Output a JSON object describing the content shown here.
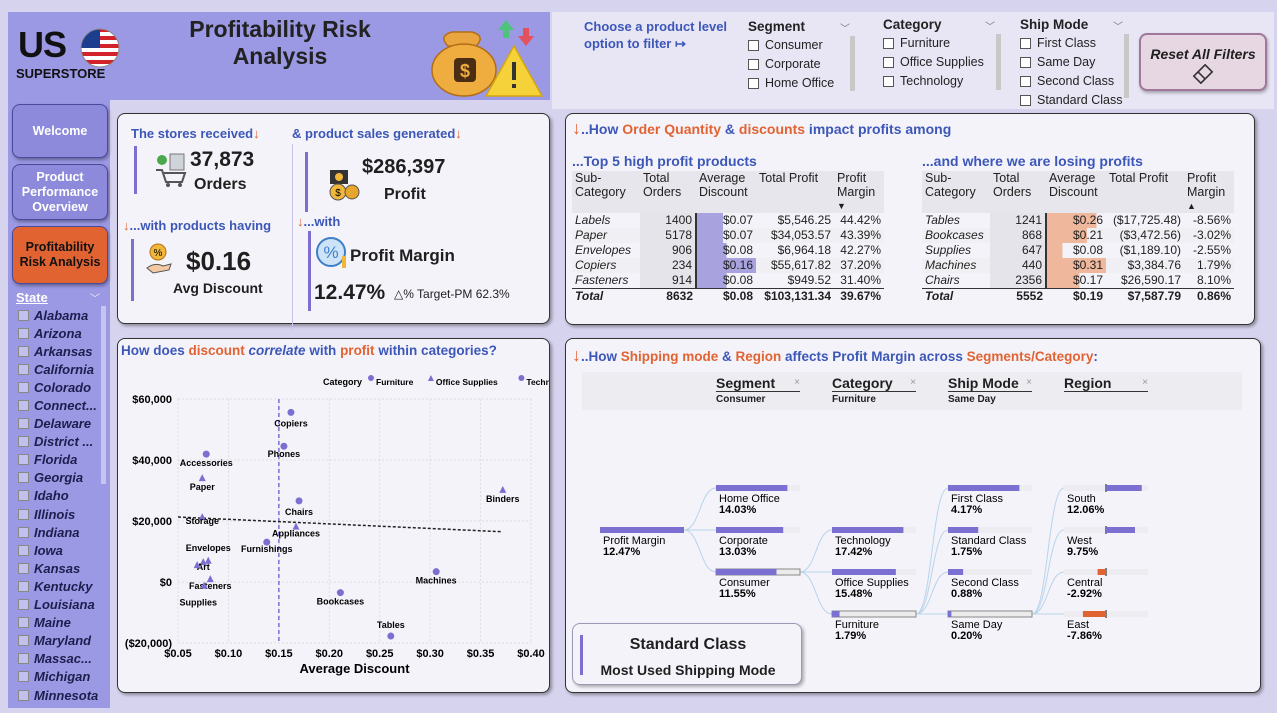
{
  "header": {
    "logo_top": "US",
    "logo_bottom": "SUPERSTORE",
    "title": "Profitability Risk Analysis"
  },
  "filters": {
    "label": "Choose a product level option to filter ↦",
    "segment": {
      "title": "Segment",
      "items": [
        "Consumer",
        "Corporate",
        "Home Office"
      ]
    },
    "category": {
      "title": "Category",
      "items": [
        "Furniture",
        "Office Supplies",
        "Technology"
      ]
    },
    "ship_mode": {
      "title": "Ship Mode",
      "items": [
        "First Class",
        "Same Day",
        "Second Class",
        "Standard Class"
      ]
    },
    "reset_label": "Reset All Filters"
  },
  "nav": {
    "welcome": "Welcome",
    "product": "Product Performance Overview",
    "risk": "Profitability Risk Analysis"
  },
  "state_filter": {
    "title": "State",
    "items": [
      "Alabama",
      "Arizona",
      "Arkansas",
      "California",
      "Colorado",
      "Connect...",
      "Delaware",
      "District ...",
      "Florida",
      "Georgia",
      "Idaho",
      "Illinois",
      "Indiana",
      "Iowa",
      "Kansas",
      "Kentucky",
      "Louisiana",
      "Maine",
      "Maryland",
      "Massac...",
      "Michigan",
      "Minnesota"
    ]
  },
  "kpi": {
    "received_label": "The stores received",
    "orders_value": "37,873",
    "orders_label": "Orders",
    "sales_label": "& product sales generated",
    "profit_value": "$286,397",
    "profit_label": "Profit",
    "having_label": "...with products having",
    "discount_value": "$0.16",
    "discount_label": "Avg Discount",
    "with_label": "...with",
    "margin_label": "Profit Margin",
    "margin_value": "12.47%",
    "target_label": "△% Target-PM 62.3%"
  },
  "tables": {
    "title_a": "..How ",
    "title_b": "Order Quantity",
    "title_c": " & ",
    "title_d": "discounts",
    "title_e": " impact profits among",
    "top_title": "...Top 5 high profit products",
    "loss_title": "...and where we are losing profits",
    "headers": [
      "Sub-Category",
      "Total Orders",
      "Average Discount",
      "Total Profit",
      "Profit Margin"
    ],
    "top": [
      [
        "Labels",
        "1400",
        "$0.07",
        "$5,546.25",
        "44.42%"
      ],
      [
        "Paper",
        "5178",
        "$0.07",
        "$34,053.57",
        "43.39%"
      ],
      [
        "Envelopes",
        "906",
        "$0.08",
        "$6,964.18",
        "42.27%"
      ],
      [
        "Copiers",
        "234",
        "$0.16",
        "$55,617.82",
        "37.20%"
      ],
      [
        "Fasteners",
        "914",
        "$0.08",
        "$949.52",
        "31.40%"
      ]
    ],
    "top_total": [
      "Total",
      "8632",
      "$0.08",
      "$103,131.34",
      "39.67%"
    ],
    "loss": [
      [
        "Tables",
        "1241",
        "$0.26",
        "($17,725.48)",
        "-8.56%"
      ],
      [
        "Bookcases",
        "868",
        "$0.21",
        "($3,472.56)",
        "-3.02%"
      ],
      [
        "Supplies",
        "647",
        "$0.08",
        "($1,189.10)",
        "-2.55%"
      ],
      [
        "Machines",
        "440",
        "$0.31",
        "$3,384.76",
        "1.79%"
      ],
      [
        "Chairs",
        "2356",
        "$0.17",
        "$26,590.17",
        "8.10%"
      ]
    ],
    "loss_total": [
      "Total",
      "5552",
      "$0.19",
      "$7,587.79",
      "0.86%"
    ]
  },
  "scatter_title": {
    "a": "How does ",
    "b": "discount",
    "c": " correlate",
    "d": " with ",
    "e": "profit",
    "f": " within categories?"
  },
  "chart_data": {
    "type": "scatter",
    "title": "",
    "xlabel": "Average Discount",
    "ylabel": "",
    "xlim": [
      0.05,
      0.4
    ],
    "ylim": [
      -20000,
      60000
    ],
    "x_ticks": [
      "$0.05",
      "$0.10",
      "$0.15",
      "$0.20",
      "$0.25",
      "$0.30",
      "$0.35",
      "$0.40"
    ],
    "y_ticks": [
      "$60,000",
      "$40,000",
      "$20,000",
      "$0",
      "($20,000)"
    ],
    "legend_title": "Category",
    "legend_position": "top-right",
    "series": [
      {
        "name": "Furniture",
        "color": "#7b6fd1",
        "marker": "circle",
        "points": [
          {
            "label": "Chairs",
            "x": 0.17,
            "y": 26590
          },
          {
            "label": "Bookcases",
            "x": 0.211,
            "y": -3473
          },
          {
            "label": "Tables",
            "x": 0.261,
            "y": -17725
          },
          {
            "label": "Furnishings",
            "x": 0.138,
            "y": 13059
          }
        ]
      },
      {
        "name": "Office Supplies",
        "color": "#7b6fd1",
        "marker": "triangle",
        "points": [
          {
            "label": "Binders",
            "x": 0.372,
            "y": 30221
          },
          {
            "label": "Paper",
            "x": 0.074,
            "y": 34054
          },
          {
            "label": "Storage",
            "x": 0.074,
            "y": 21279
          },
          {
            "label": "Appliances",
            "x": 0.167,
            "y": 18138
          },
          {
            "label": "Envelopes",
            "x": 0.08,
            "y": 6964
          },
          {
            "label": "Art",
            "x": 0.075,
            "y": 6528
          },
          {
            "label": "Fasteners",
            "x": 0.082,
            "y": 950
          },
          {
            "label": "Supplies",
            "x": 0.076,
            "y": -1189
          },
          {
            "label": "Labels",
            "x": 0.069,
            "y": 5546
          }
        ]
      },
      {
        "name": "Technology",
        "color": "#7b6fd1",
        "marker": "circle",
        "points": [
          {
            "label": "Copiers",
            "x": 0.162,
            "y": 55618
          },
          {
            "label": "Phones",
            "x": 0.155,
            "y": 44516
          },
          {
            "label": "Accessories",
            "x": 0.078,
            "y": 41937
          },
          {
            "label": "Machines",
            "x": 0.306,
            "y": 3385
          }
        ]
      }
    ],
    "trendline": {
      "x": [
        0.05,
        0.37
      ],
      "y": [
        21300,
        16500
      ]
    },
    "reference_x": 0.15
  },
  "tree": {
    "title_a": "..How ",
    "title_b": "Shipping mode",
    "title_c": " & ",
    "title_d": "Region",
    "title_e": " affects ",
    "title_f": "Profit Margin",
    "title_g": " across ",
    "title_h": "Segments/Category",
    "title_i": ":",
    "levels": [
      {
        "title": "Segment",
        "selected": "Consumer"
      },
      {
        "title": "Category",
        "selected": "Furniture"
      },
      {
        "title": "Ship Mode",
        "selected": "Same Day"
      },
      {
        "title": "Region",
        "selected": ""
      }
    ],
    "root": {
      "label": "Profit Margin",
      "value": "12.47%"
    },
    "segment": [
      {
        "label": "Home Office",
        "value": "14.03%",
        "fill": 0.85
      },
      {
        "label": "Corporate",
        "value": "13.03%",
        "fill": 0.8
      },
      {
        "label": "Consumer",
        "value": "11.55%",
        "fill": 0.72
      }
    ],
    "category": [
      {
        "label": "Technology",
        "value": "17.42%",
        "fill": 0.85
      },
      {
        "label": "Office Supplies",
        "value": "15.48%",
        "fill": 0.76
      },
      {
        "label": "Furniture",
        "value": "1.79%",
        "fill": 0.09
      }
    ],
    "shipmode": [
      {
        "label": "First Class",
        "value": "4.17%",
        "fill": 0.85
      },
      {
        "label": "Standard Class",
        "value": "1.75%",
        "fill": 0.36
      },
      {
        "label": "Second Class",
        "value": "0.88%",
        "fill": 0.18
      },
      {
        "label": "Same Day",
        "value": "0.20%",
        "fill": 0.04
      }
    ],
    "region": [
      {
        "label": "South",
        "value": "12.06%",
        "fill": 0.85,
        "neg": false
      },
      {
        "label": "West",
        "value": "9.75%",
        "fill": 0.69,
        "neg": false
      },
      {
        "label": "Central",
        "value": "-2.92%",
        "fill": 0.2,
        "neg": true
      },
      {
        "label": "East",
        "value": "-7.86%",
        "fill": 0.55,
        "neg": true
      }
    ],
    "card_title": "Standard Class",
    "card_sub": "Most Used Shipping Mode"
  }
}
